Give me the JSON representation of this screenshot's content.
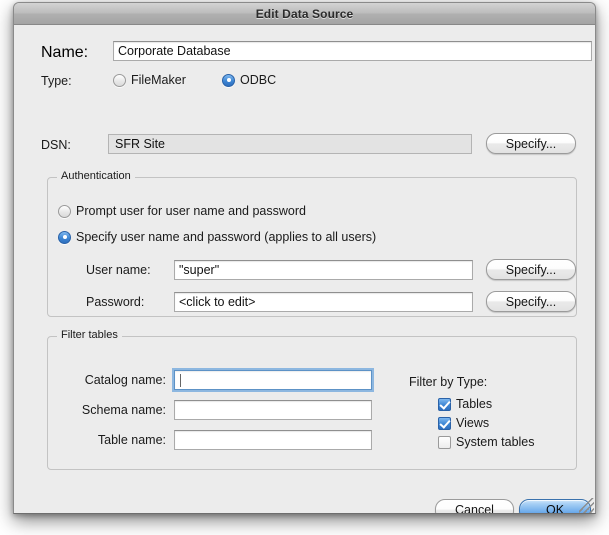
{
  "window": {
    "title": "Edit Data Source"
  },
  "name_row": {
    "label": "Name:",
    "value": "Corporate Database"
  },
  "type_row": {
    "label": "Type:",
    "options": [
      {
        "label": "FileMaker",
        "selected": false
      },
      {
        "label": "ODBC",
        "selected": true
      }
    ]
  },
  "dsn_row": {
    "label": "DSN:",
    "value": "SFR Site",
    "button": "Specify..."
  },
  "authentication": {
    "title": "Authentication",
    "options": [
      {
        "label": "Prompt user for user name and password",
        "selected": false
      },
      {
        "label": "Specify user name and password (applies to all users)",
        "selected": true
      }
    ],
    "user_name": {
      "label": "User name:",
      "value": "\"super\"",
      "button": "Specify..."
    },
    "password": {
      "label": "Password:",
      "value": "<click to edit>",
      "button": "Specify..."
    }
  },
  "filter_tables": {
    "title": "Filter tables",
    "fields": [
      {
        "label": "Catalog name:",
        "value": "",
        "focused": true
      },
      {
        "label": "Schema name:",
        "value": "",
        "focused": false
      },
      {
        "label": "Table name:",
        "value": "",
        "focused": false
      }
    ],
    "filter_by_type": {
      "label": "Filter by Type:",
      "items": [
        {
          "label": "Tables",
          "checked": true
        },
        {
          "label": "Views",
          "checked": true
        },
        {
          "label": "System tables",
          "checked": false
        }
      ]
    }
  },
  "footer": {
    "cancel": "Cancel",
    "ok": "OK"
  },
  "colors": {
    "accent": "#3d86d4",
    "window_bg": "#ececec",
    "focus_ring": "#6ea5dc"
  }
}
